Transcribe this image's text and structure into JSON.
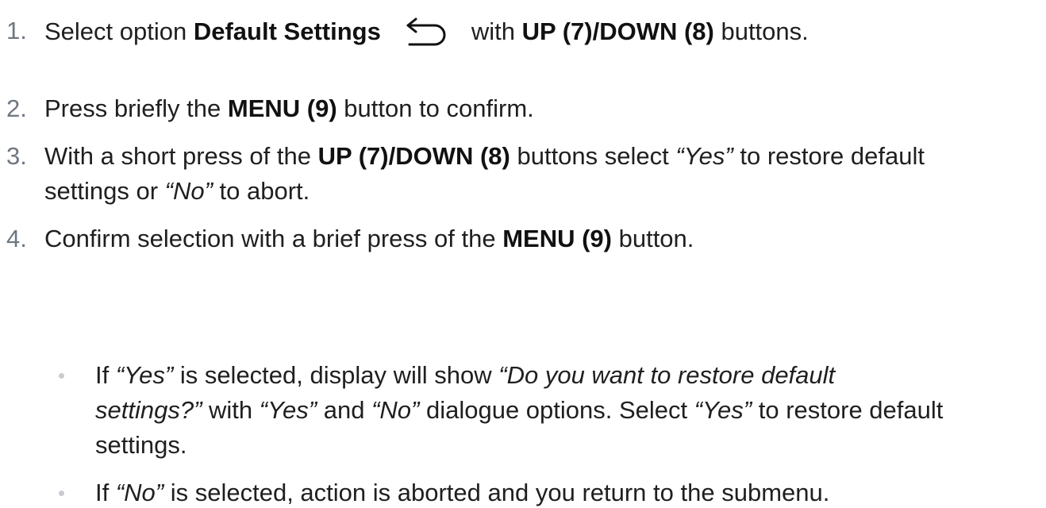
{
  "steps": [
    {
      "number": "1.",
      "text_a": "Select option ",
      "bold_a": "Default Settings",
      "icon": "back-arrow-icon",
      "text_b": "with ",
      "bold_b": "UP (7)/DOWN (8)",
      "text_c": " buttons."
    },
    {
      "number": "2.",
      "text_a": "Press briefly the ",
      "bold_a": "MENU (9)",
      "text_b": " button to confirm."
    },
    {
      "number": "3.",
      "text_a": "With a short press of the ",
      "bold_a": "UP (7)/DOWN (8)",
      "text_b": " buttons select ",
      "italic_a": "“Yes”",
      "text_c": " to restore default",
      "text_d": "settings or ",
      "italic_b": "“No”",
      "text_e": " to abort."
    },
    {
      "number": "4.",
      "text_a": "Confirm selection with a brief press of the ",
      "bold_a": "MENU (9)",
      "text_b": " button."
    }
  ],
  "notes": [
    {
      "text_a": "If ",
      "italic_a": "“Yes”",
      "text_b": " is selected, display will show ",
      "italic_b": "“Do you want to restore default",
      "italic_c": "settings?”",
      "text_c": " with ",
      "italic_d": "“Yes”",
      "text_d": " and ",
      "italic_e": "“No”",
      "text_e": " dialogue options. Select ",
      "italic_f": "“Yes”",
      "text_f": " to restore default",
      "text_g": "settings."
    },
    {
      "text_a": "If ",
      "italic_a": "“No”",
      "text_b": " is selected, action is aborted and you return to the submenu."
    }
  ]
}
